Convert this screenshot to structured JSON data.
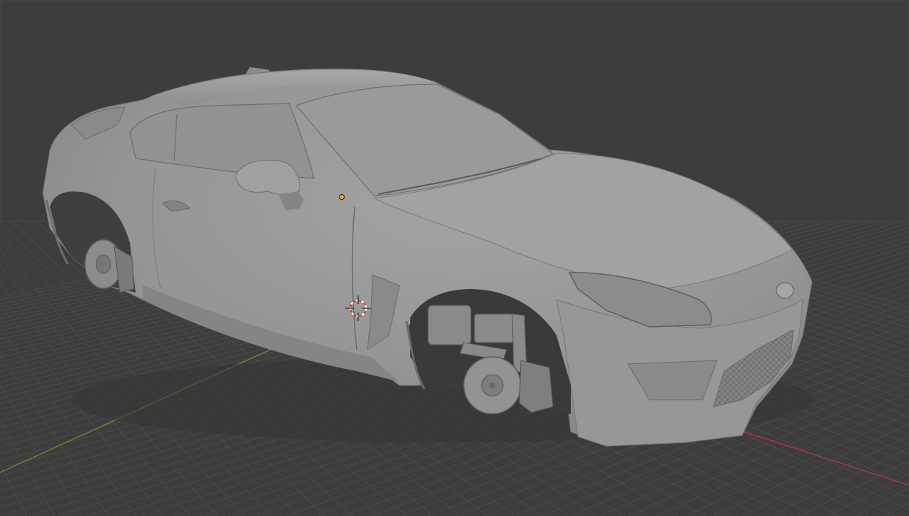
{
  "viewport": {
    "mode": "solid-shading",
    "background_color": "#3d3d3d",
    "grid_color": "#4a4a4a",
    "x_axis_color": "#b8353b",
    "y_axis_color": "#6b9a2a",
    "model_color": "#9b9b9b",
    "cursor_color": "#d8302c",
    "origin_color": "#f5a623"
  },
  "scene_objects": [
    {
      "name": "car-body",
      "selected": false
    },
    {
      "name": "3d-cursor",
      "selected": false
    },
    {
      "name": "object-origin",
      "selected": true
    }
  ]
}
